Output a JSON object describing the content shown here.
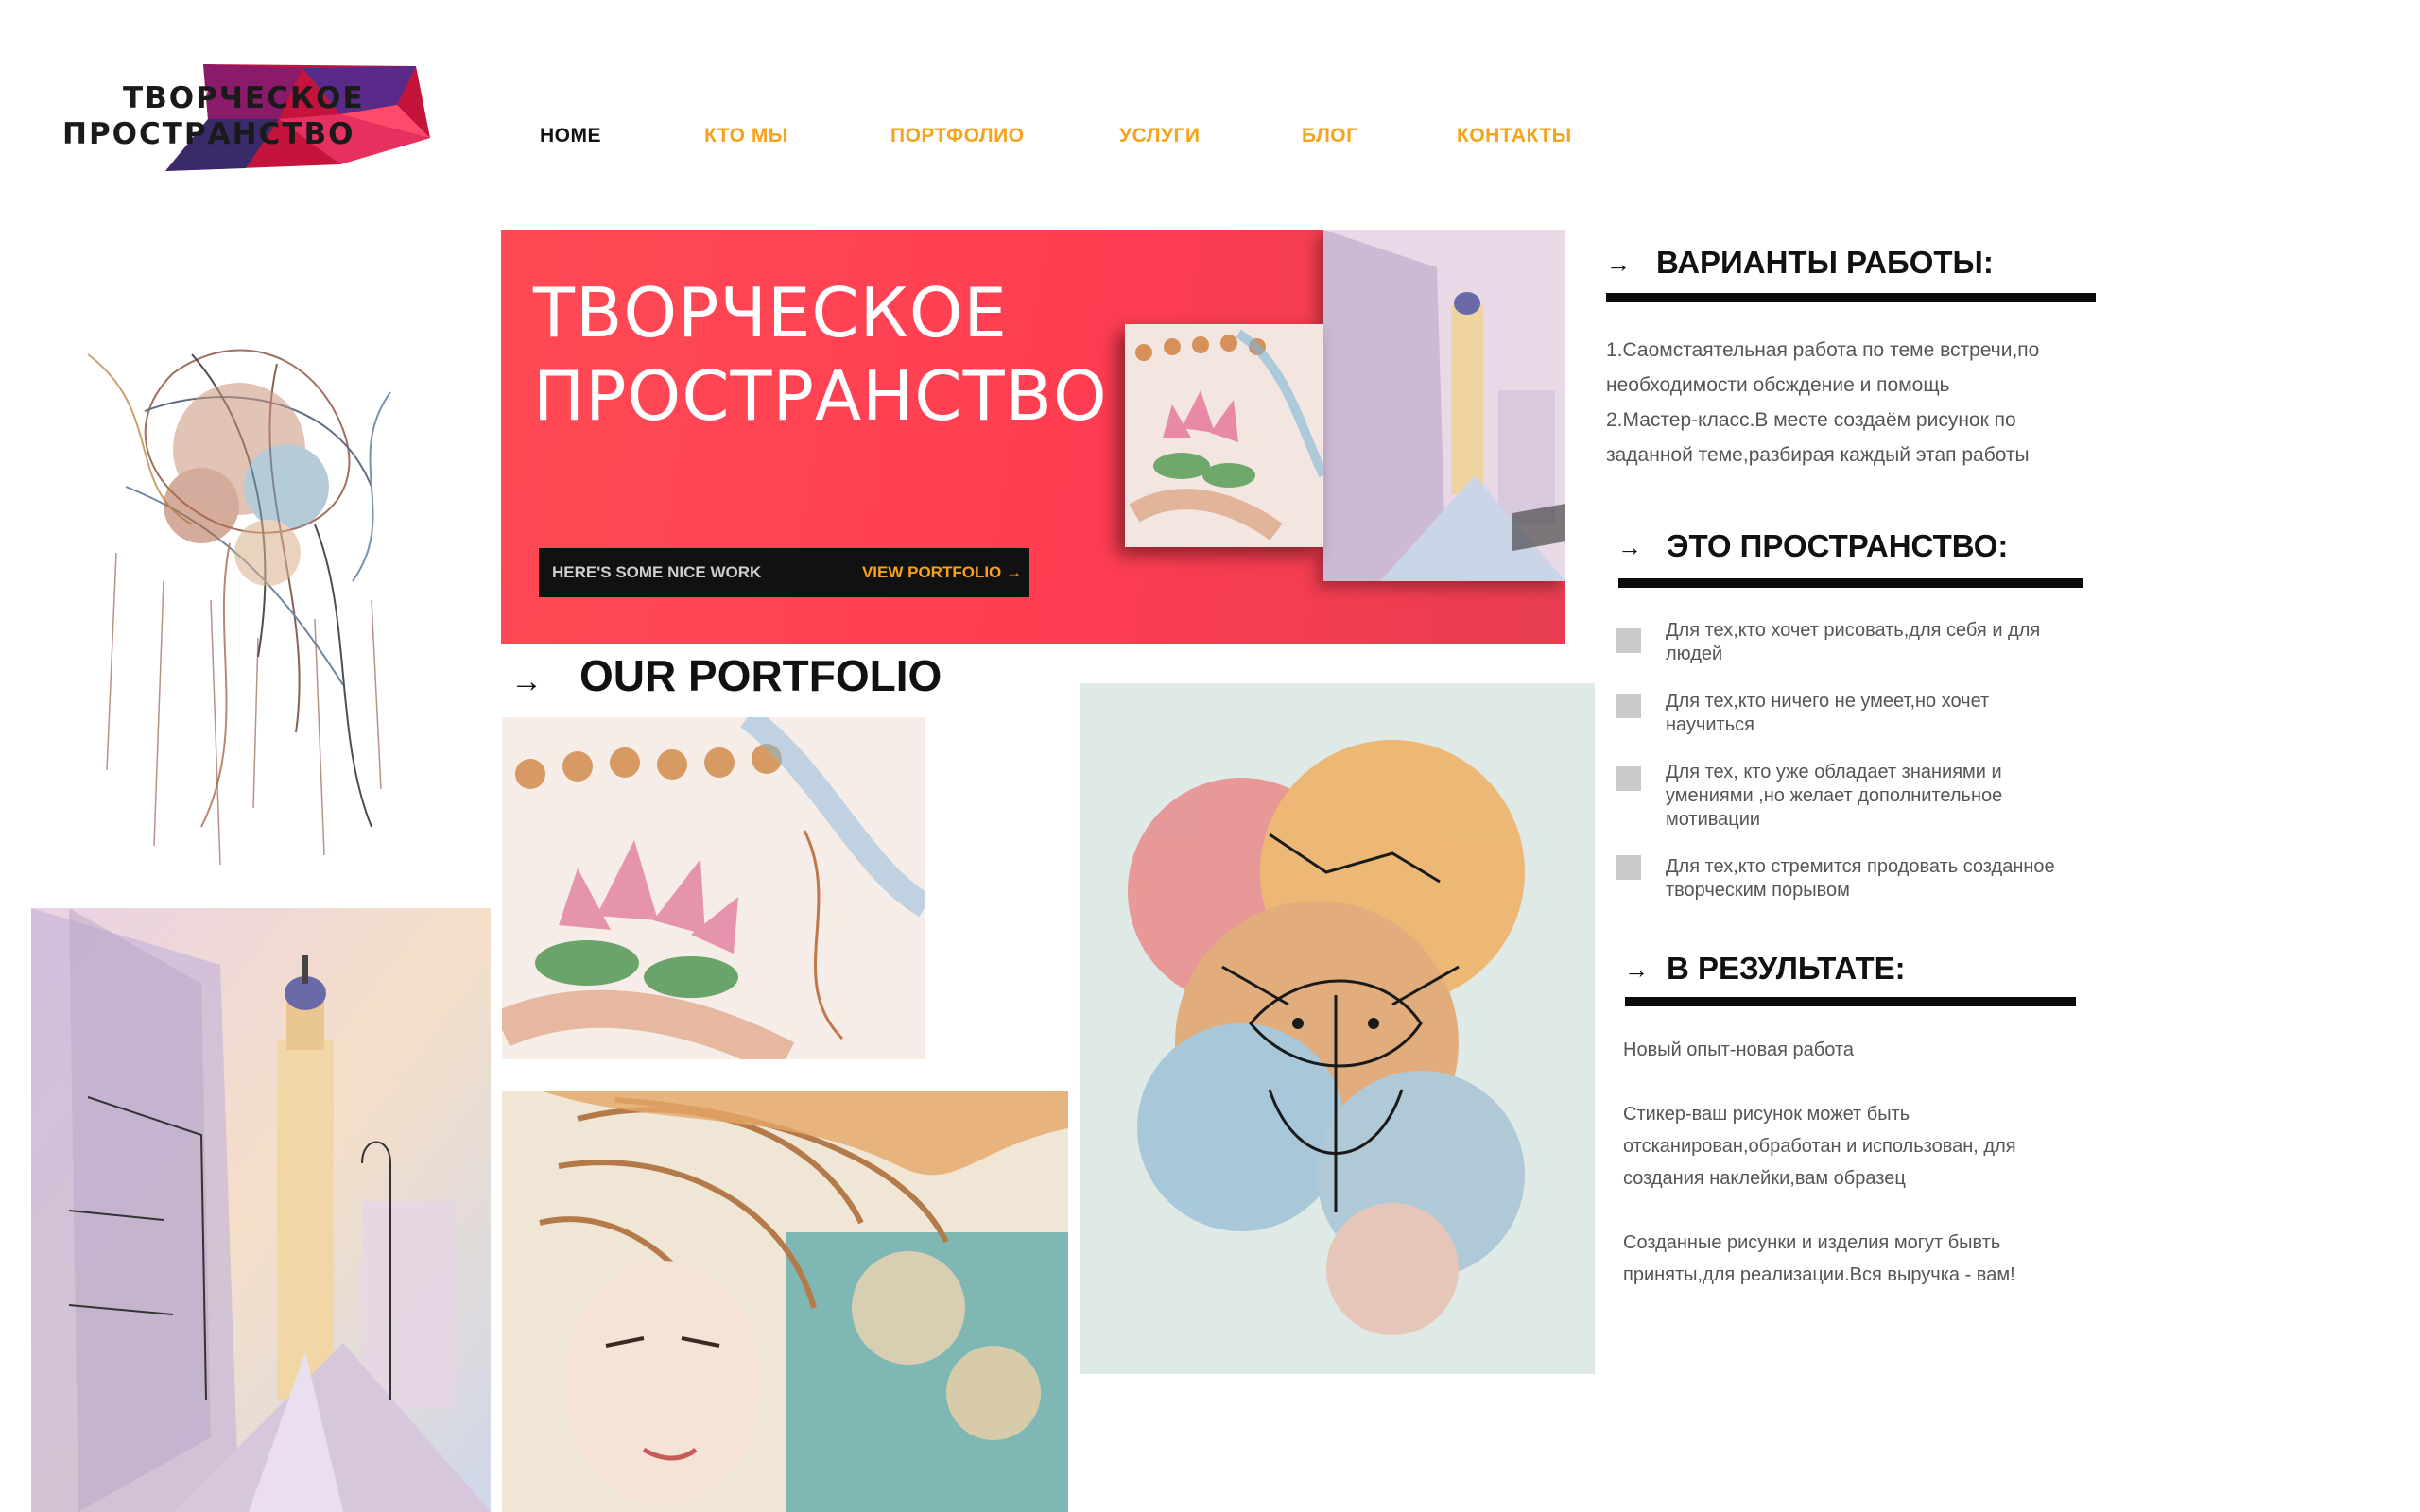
{
  "logo": {
    "line1": "ТВОРЧЕСКОЕ",
    "line2": "ПРОСТРАНСТВО"
  },
  "nav": [
    {
      "label": "HOME",
      "active": true
    },
    {
      "label": "КТО МЫ"
    },
    {
      "label": "ПОРТФОЛИО"
    },
    {
      "label": "УСЛУГИ"
    },
    {
      "label": "БЛОГ"
    },
    {
      "label": "КОНТАКТЫ"
    }
  ],
  "hero": {
    "title_line1": "ТВОРЧЕСКОЕ",
    "title_line2": "ПРОСТРАНСТВО",
    "tagline": "HERE'S SOME NICE WORK",
    "cta": "VIEW PORTFOLIO →"
  },
  "portfolio": {
    "arrow": "→",
    "title": "OUR PORTFOLIO"
  },
  "variants": {
    "arrow": "→",
    "title": "ВАРИАНТЫ РАБОТЫ:",
    "lines": [
      "1.Саомстаятельная работа по теме встречи,по",
      "необходимости обсждение и помощь",
      "2.Мастер-класс.В месте создаём рисунок по",
      "заданной теме,разбирая каждый этап работы"
    ]
  },
  "space": {
    "arrow": "→",
    "title": "ЭТО ПРОСТРАНСТВО:",
    "items": [
      "Для тех,кто хочет рисовать,для себя и для людей",
      "Для тех,кто ничего не умеет,но хочет научиться",
      "Для тех, кто уже обладает знаниями и умениями ,но желает дополнительное мотивации",
      "Для тех,кто стремится продовать созданное творческим порывом"
    ]
  },
  "result": {
    "arrow": "→",
    "title": "В РЕЗУЛЬТАТЕ:",
    "p1": "Новый опыт-новая работа",
    "p2a": "Стикер-ваш рисунок может быть",
    "p2b": "отсканирован,обработан и использован, для",
    "p2c": "создания наклейки,вам образец",
    "p3a": "Созданные рисунки и изделия могут бывть",
    "p3b": "приняты,для реализации.Вся выручка - вам!"
  },
  "colors": {
    "accent": "#f7a21b",
    "hero_red": "#ff4052",
    "text_dark": "#111111"
  }
}
